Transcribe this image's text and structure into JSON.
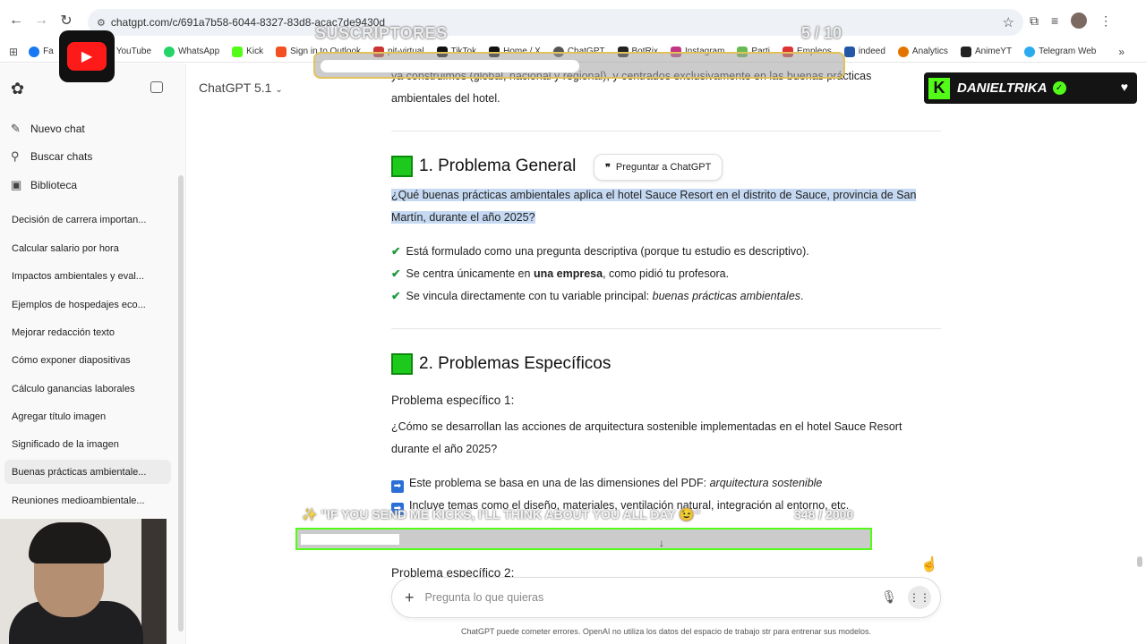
{
  "browser": {
    "url": "chatgpt.com/c/691a7b58-6044-8327-83d8-acac7de9430d",
    "bookmarks": [
      "Fa",
      "YouTube",
      "WhatsApp",
      "Kick",
      "Sign in to Outlook",
      "pit-virtual",
      "TikTok",
      "Home / X",
      "ChatGPT",
      "BotRix",
      "Instagram",
      "Parti",
      "Empleos",
      "indeed",
      "Analytics",
      "AnimeYT",
      "Telegram Web"
    ]
  },
  "overlay": {
    "subs_label": "SUSCRIPTORES",
    "subs_count": "5 / 10",
    "subs_progress": 0.5,
    "kick_name": "DANIELTRIKA",
    "kick_message": "\"IF YOU SEND ME KICKS, I'LL THINK ABOUT YOU ALL DAY 😉\"",
    "kick_count": "348 / 2000",
    "kick_progress": 0.174
  },
  "sidebar": {
    "actions": [
      {
        "label": "Nuevo chat",
        "icon": "edit-icon"
      },
      {
        "label": "Buscar chats",
        "icon": "search-icon"
      },
      {
        "label": "Biblioteca",
        "icon": "library-icon"
      }
    ],
    "history": [
      "Decisión de carrera importan...",
      "Calcular salario por hora",
      "Impactos ambientales y eval...",
      "Ejemplos de hospedajes eco...",
      "Mejorar redacción texto",
      "Cómo exponer diapositivas",
      "Cálculo ganancias laborales",
      "Agregar título imagen",
      "Significado de la imagen",
      "Buenas prácticas ambientale...",
      "Reuniones medioambientale..."
    ],
    "active_index": 9
  },
  "main": {
    "model": "ChatGPT 5.1",
    "intro_line1": "ya construimos (global, nacional y regional), y centrados exclusivamente en las buenas prácticas",
    "intro_line2": "ambientales del hotel.",
    "section1_title": "1. Problema General",
    "ask_button": "Preguntar a ChatGPT",
    "question1_line1": "¿Qué buenas prácticas ambientales aplica el hotel Sauce Resort en el distrito de Sauce, provincia de San",
    "question1_line2": "Martín, durante el año 2025?",
    "check1": "Está formulado como una pregunta descriptiva (porque tu estudio es descriptivo).",
    "check2_pre": "Se centra únicamente en ",
    "check2_bold": "una empresa",
    "check2_post": ", como pidió tu profesora.",
    "check3_pre": "Se vincula directamente con tu variable principal: ",
    "check3_italic": "buenas prácticas ambientales",
    "check3_post": ".",
    "section2_title": "2. Problemas Específicos",
    "sub1_title": "Problema específico 1:",
    "sub1_q_line1": "¿Cómo se desarrollan las acciones de arquitectura sostenible implementadas en el hotel Sauce Resort",
    "sub1_q_line2": "durante el año 2025?",
    "arrow1_pre": "Este problema se basa en una de las dimensiones del PDF: ",
    "arrow1_italic": "arquitectura sostenible",
    "arrow2": "Incluye temas como el diseño, materiales, ventilación natural, integración al entorno, etc.",
    "sub2_title": "Problema específico 2:"
  },
  "composer": {
    "placeholder": "Pregunta lo que quieras",
    "footer": "ChatGPT puede cometer errores. OpenAI no utiliza los datos del espacio de trabajo str para entrenar sus modelos."
  }
}
